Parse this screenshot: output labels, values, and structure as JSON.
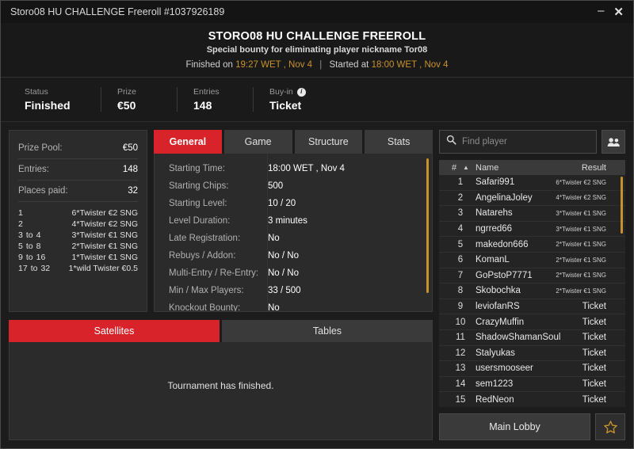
{
  "window": {
    "title": "Storo08 HU CHALLENGE Freeroll #1037926189",
    "minimize_label": "–",
    "close_label": "✕"
  },
  "header": {
    "title": "STORO08 HU CHALLENGE FREEROLL",
    "subtitle": "Special bounty for eliminating player nickname Tor08",
    "finished_prefix": "Finished on",
    "finished_time": "19:27 WET , Nov 4",
    "separator": "|",
    "started_prefix": "Started at",
    "started_time": "18:00 WET , Nov 4"
  },
  "status_strip": [
    {
      "label": "Status",
      "value": "Finished",
      "has_info": false
    },
    {
      "label": "Prize",
      "value": "€50",
      "has_info": false
    },
    {
      "label": "Entries",
      "value": "148",
      "has_info": false
    },
    {
      "label": "Buy-in",
      "value": "Ticket",
      "has_info": true,
      "info_icon": "info-icon"
    }
  ],
  "prize_panel": {
    "rows": [
      {
        "key": "Prize Pool:",
        "value": "€50"
      },
      {
        "key": "Entries:",
        "value": "148"
      },
      {
        "key": "Places paid:",
        "value": "32"
      }
    ],
    "payouts": [
      {
        "from": "1",
        "to": "",
        "sep": "",
        "prize": "6*Twister €2 SNG"
      },
      {
        "from": "2",
        "to": "",
        "sep": "",
        "prize": "4*Twister €2 SNG"
      },
      {
        "from": "3",
        "to": "4",
        "sep": "to",
        "prize": "3*Twister €1 SNG"
      },
      {
        "from": "5",
        "to": "8",
        "sep": "to",
        "prize": "2*Twister €1 SNG"
      },
      {
        "from": "9",
        "to": "16",
        "sep": "to",
        "prize": "1*Twister €1 SNG"
      },
      {
        "from": "17",
        "to": "32",
        "sep": "to",
        "prize": "1*wild Twister €0.5"
      }
    ]
  },
  "tabs": [
    {
      "label": "General",
      "active": true
    },
    {
      "label": "Game",
      "active": false
    },
    {
      "label": "Structure",
      "active": false
    },
    {
      "label": "Stats",
      "active": false
    }
  ],
  "general_info": [
    {
      "key": "Starting Time:",
      "value": "18:00 WET , Nov 4"
    },
    {
      "key": "Starting Chips:",
      "value": "500"
    },
    {
      "key": "Starting Level:",
      "value": "10 / 20"
    },
    {
      "key": "Level Duration:",
      "value": "3 minutes"
    },
    {
      "key": "Late Registration:",
      "value": "No"
    },
    {
      "key": "Rebuys / Addon:",
      "value": "No / No"
    },
    {
      "key": "Multi-Entry / Re-Entry:",
      "value": "No / No"
    },
    {
      "key": "Min / Max Players:",
      "value": "33 / 500"
    },
    {
      "key": "Knockout Bounty:",
      "value": "No"
    }
  ],
  "bottom_tabs": [
    {
      "label": "Satellites",
      "active": true
    },
    {
      "label": "Tables",
      "active": false
    }
  ],
  "bottom_message": "Tournament has finished.",
  "search": {
    "placeholder": "Find player",
    "value": "",
    "icon": "search-icon",
    "people_icon": "people-icon"
  },
  "player_table": {
    "columns": {
      "num": "#",
      "sort": "▲",
      "name": "Name",
      "result": "Result"
    },
    "rows": [
      {
        "num": "1",
        "name": "Safari991",
        "result": "6*Twister €2 SNG",
        "small": true
      },
      {
        "num": "2",
        "name": "AngelinaJoley",
        "result": "4*Twister €2 SNG",
        "small": true
      },
      {
        "num": "3",
        "name": "Natarehs",
        "result": "3*Twister €1 SNG",
        "small": true
      },
      {
        "num": "4",
        "name": "ngrred66",
        "result": "3*Twister €1 SNG",
        "small": true
      },
      {
        "num": "5",
        "name": "makedon666",
        "result": "2*Twister €1 SNG",
        "small": true
      },
      {
        "num": "6",
        "name": "KomanL",
        "result": "2*Twister €1 SNG",
        "small": true
      },
      {
        "num": "7",
        "name": "GoPstoP7771",
        "result": "2*Twister €1 SNG",
        "small": true
      },
      {
        "num": "8",
        "name": "Skobochka",
        "result": "2*Twister €1 SNG",
        "small": true
      },
      {
        "num": "9",
        "name": "leviofanRS",
        "result": "Ticket",
        "small": false
      },
      {
        "num": "10",
        "name": "CrazyMuffin",
        "result": "Ticket",
        "small": false
      },
      {
        "num": "11",
        "name": "ShadowShamanSoul",
        "result": "Ticket",
        "small": false
      },
      {
        "num": "12",
        "name": "Stalyukas",
        "result": "Ticket",
        "small": false
      },
      {
        "num": "13",
        "name": "usersmooseer",
        "result": "Ticket",
        "small": false
      },
      {
        "num": "14",
        "name": "sem1223",
        "result": "Ticket",
        "small": false
      },
      {
        "num": "15",
        "name": "RedNeon",
        "result": "Ticket",
        "small": false
      }
    ]
  },
  "footer": {
    "lobby_label": "Main Lobby",
    "favorite_icon": "star-icon"
  },
  "colors": {
    "accent_red": "#d8232a",
    "accent_gold": "#c8922c",
    "panel_bg": "#2b2b2b",
    "window_bg": "#1c1c1c"
  }
}
